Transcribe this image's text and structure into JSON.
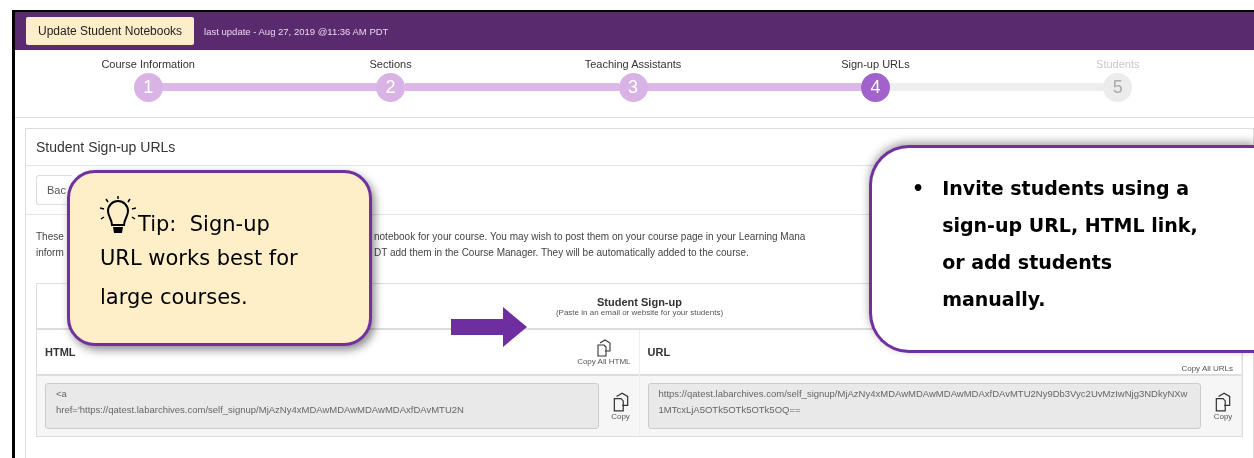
{
  "header": {
    "button": "Update Student Notebooks",
    "last_update": "last update - Aug 27, 2019 @11:36 AM PDT"
  },
  "steps": [
    {
      "label": "Course Information",
      "number": "1",
      "completed": true,
      "selected": false
    },
    {
      "label": "Sections",
      "number": "2",
      "completed": true,
      "selected": false
    },
    {
      "label": "Teaching Assistants",
      "number": "3",
      "completed": true,
      "selected": false
    },
    {
      "label": "Sign-up URLs",
      "number": "4",
      "completed": false,
      "selected": true
    },
    {
      "label": "Students",
      "number": "5",
      "completed": false,
      "selected": false
    }
  ],
  "panel": {
    "title": "Student Sign-up URLs",
    "back_button": "Bac",
    "paragraph_left": [
      "These",
      "inform"
    ],
    "paragraph_right": [
      "notebook for your course. You may wish to post them on your course page in your Learning Mana",
      "DT add them in the Course Manager. They will be automatically added to the course."
    ],
    "table": {
      "title": "Student Sign-up",
      "subtitle": "(Paste in an email or website for your students)",
      "columns": [
        {
          "name": "HTML",
          "copy_all": "Copy All HTML"
        },
        {
          "name": "URL",
          "copy_all": "Copy All URLs"
        }
      ],
      "row": [
        {
          "value": "<a\nhref='https://qatest.labarchives.com/self_signup/MjAzNy4xMDAwMDAwMDAwMDAxfDAvMTU2N",
          "copy": "Copy"
        },
        {
          "value": "https://qatest.labarchives.com/self_signup/MjAzNy4xMDAwMDAwMDAwMDAxfDAvMTU2Ny9Db3Vyc2UvMzIwNjg3NDkyNXw1MTcxLjA5OTk5OTk5OTk5OQ==",
          "copy": "Copy"
        }
      ]
    }
  },
  "tip_callout": {
    "first_line": "Tip:  Sign-up",
    "rest": "URL works best for large courses."
  },
  "info_callout": {
    "bullets": [
      {
        "marker": "•",
        "text": "Invite students using a sign-up URL, HTML link, or add students manually."
      }
    ]
  }
}
